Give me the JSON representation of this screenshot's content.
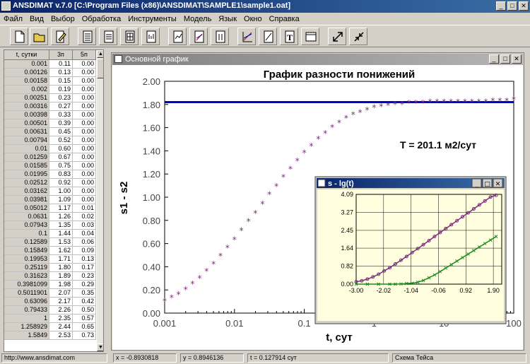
{
  "app": {
    "title": "ANSDIMAT v.7.0  [C:\\Program Files (x86)\\ANSDIMAT\\SAMPLE1\\sample1.oat]"
  },
  "menu": [
    "Файл",
    "Вид",
    "Выбор",
    "Обработка",
    "Инструменты",
    "Модель",
    "Язык",
    "Окно",
    "Справка"
  ],
  "toolbar": {
    "buttons": [
      "new-file-icon",
      "open-folder-icon",
      "edit-icon",
      "table-icon",
      "page-icon",
      "sheet-icon",
      "print-preview-icon",
      "document-icon",
      "doc-chart-icon",
      "columns-icon",
      "chart-icon",
      "line-tool-icon",
      "text-icon",
      "window-icon",
      "expand-icon",
      "shrink-icon"
    ]
  },
  "table": {
    "headers": [
      "t, сутки",
      "3п",
      "5п"
    ],
    "rows": [
      [
        "0.001",
        "0.11",
        "0.00"
      ],
      [
        "0.00126",
        "0.13",
        "0.00"
      ],
      [
        "0.00158",
        "0.15",
        "0.00"
      ],
      [
        "0.002",
        "0.19",
        "0.00"
      ],
      [
        "0.00251",
        "0.23",
        "0.00"
      ],
      [
        "0.00316",
        "0.27",
        "0.00"
      ],
      [
        "0.00398",
        "0.33",
        "0.00"
      ],
      [
        "0.00501",
        "0.39",
        "0.00"
      ],
      [
        "0.00631",
        "0.45",
        "0.00"
      ],
      [
        "0.00794",
        "0.52",
        "0.00"
      ],
      [
        "0.01",
        "0.60",
        "0.00"
      ],
      [
        "0.01259",
        "0.67",
        "0.00"
      ],
      [
        "0.01585",
        "0.75",
        "0.00"
      ],
      [
        "0.01995",
        "0.83",
        "0.00"
      ],
      [
        "0.02512",
        "0.92",
        "0.00"
      ],
      [
        "0.03162",
        "1.00",
        "0.00"
      ],
      [
        "0.03981",
        "1.09",
        "0.00"
      ],
      [
        "0.05012",
        "1.17",
        "0.01"
      ],
      [
        "0.0631",
        "1.26",
        "0.02"
      ],
      [
        "0.07943",
        "1.35",
        "0.03"
      ],
      [
        "0.1",
        "1.44",
        "0.04"
      ],
      [
        "0.12589",
        "1.53",
        "0.06"
      ],
      [
        "0.15849",
        "1.62",
        "0.09"
      ],
      [
        "0.19953",
        "1.71",
        "0.13"
      ],
      [
        "0.25119",
        "1.80",
        "0.17"
      ],
      [
        "0.31623",
        "1.89",
        "0.23"
      ],
      [
        "0.3981099",
        "1.98",
        "0.29"
      ],
      [
        "0.5011901",
        "2.07",
        "0.35"
      ],
      [
        "0.63096",
        "2.17",
        "0.42"
      ],
      [
        "0.79433",
        "2.26",
        "0.50"
      ],
      [
        "1",
        "2.35",
        "0.57"
      ],
      [
        "1.258929",
        "2.44",
        "0.65"
      ],
      [
        "1.5849",
        "2.53",
        "0.73"
      ]
    ]
  },
  "graph_window": {
    "title": "Основной график"
  },
  "chart_data": [
    {
      "type": "scatter",
      "title": "График разности понижений",
      "xlabel": "t, сут",
      "ylabel": "s1 - s2",
      "xscale": "log",
      "xlim": [
        0.001,
        100
      ],
      "ylim": [
        0,
        2
      ],
      "x_ticks": [
        "0.001",
        "0.01",
        "0.1",
        "1",
        "10",
        "100"
      ],
      "y_ticks": [
        "0.00",
        "0.20",
        "0.40",
        "0.60",
        "0.80",
        "1.00",
        "1.20",
        "1.40",
        "1.60",
        "1.80",
        "2.00"
      ],
      "annotation": "T = 201.1 м2/сут",
      "horizontal_line": 1.82,
      "series": [
        {
          "color": "#7b2d7b",
          "marker": "star",
          "x": [
            0.001,
            0.00126,
            0.00158,
            0.002,
            0.00251,
            0.00316,
            0.00398,
            0.00501,
            0.00631,
            0.00794,
            0.01,
            0.01259,
            0.01585,
            0.01995,
            0.02512,
            0.03162,
            0.03981,
            0.05012,
            0.0631,
            0.07943,
            0.1,
            0.12589,
            0.15849,
            0.19953,
            0.25119,
            0.31623,
            0.39811,
            0.50119,
            0.63096,
            0.79433,
            1,
            1.2589,
            1.5849,
            1.9953,
            2.5119,
            3.1623,
            3.9811,
            5.0119,
            6.3096,
            7.9433,
            10,
            12.589,
            15.849,
            19.953,
            25.119,
            31.623,
            39.811,
            50.119,
            63.096,
            79.433,
            100
          ],
          "y": [
            0.1,
            0.13,
            0.16,
            0.2,
            0.25,
            0.3,
            0.36,
            0.42,
            0.49,
            0.56,
            0.63,
            0.71,
            0.79,
            0.86,
            0.94,
            1.02,
            1.09,
            1.17,
            1.24,
            1.31,
            1.38,
            1.44,
            1.5,
            1.55,
            1.6,
            1.64,
            1.68,
            1.71,
            1.73,
            1.75,
            1.77,
            1.78,
            1.79,
            1.8,
            1.8,
            1.81,
            1.81,
            1.81,
            1.82,
            1.82,
            1.82,
            1.82,
            1.82,
            1.82,
            1.82,
            1.82,
            1.82,
            1.83,
            1.83,
            1.83,
            1.84
          ]
        }
      ],
      "grid": false,
      "colors": {
        "line": "#0000cc",
        "points": "#7b2d7b"
      }
    },
    {
      "type": "scatter",
      "title": "s - lg(t)",
      "xlim": [
        -3,
        2.2
      ],
      "ylim": [
        0,
        4.09
      ],
      "x_ticks": [
        "-3.00",
        "-2.02",
        "-1.04",
        "-0.06",
        "0.92",
        "1.90"
      ],
      "y_ticks": [
        "0.00",
        "0.82",
        "1.64",
        "2.45",
        "3.27",
        "4.09"
      ],
      "grid": true,
      "series": [
        {
          "color": "#7b2d7b",
          "marker": "circle",
          "x": [
            -3.0,
            -2.8,
            -2.6,
            -2.4,
            -2.2,
            -2.0,
            -1.8,
            -1.6,
            -1.4,
            -1.2,
            -1.0,
            -0.8,
            -0.6,
            -0.4,
            -0.2,
            0.0,
            0.2,
            0.4,
            0.6,
            0.8,
            1.0,
            1.2,
            1.4,
            1.6,
            1.8,
            2.0
          ],
          "y": [
            0.11,
            0.15,
            0.23,
            0.33,
            0.45,
            0.6,
            0.75,
            0.92,
            1.09,
            1.26,
            1.44,
            1.62,
            1.8,
            1.98,
            2.17,
            2.35,
            2.53,
            2.71,
            2.89,
            3.07,
            3.25,
            3.43,
            3.61,
            3.79,
            3.97,
            4.05
          ]
        },
        {
          "color": "#1a8a1a",
          "marker": "x",
          "x": [
            -3.0,
            -2.6,
            -2.2,
            -1.8,
            -1.6,
            -1.4,
            -1.2,
            -1.0,
            -0.8,
            -0.6,
            -0.4,
            -0.2,
            0.0,
            0.2,
            0.4,
            0.6,
            0.8,
            1.0,
            1.2,
            1.4,
            1.6,
            1.8,
            2.0
          ],
          "y": [
            0,
            0,
            0,
            0,
            0,
            0.01,
            0.03,
            0.04,
            0.09,
            0.17,
            0.29,
            0.42,
            0.57,
            0.73,
            0.89,
            1.05,
            1.21,
            1.37,
            1.53,
            1.69,
            1.85,
            2.01,
            2.17
          ]
        }
      ]
    }
  ],
  "inset_window": {
    "title": "s - lg(t)"
  },
  "statusbar": {
    "url": "http://www.ansdimat.com",
    "x": "x = -0.8930818",
    "y": "y = 0.8946136",
    "t": "t = 0.127914 сут",
    "scheme": "Схема Тейса"
  }
}
